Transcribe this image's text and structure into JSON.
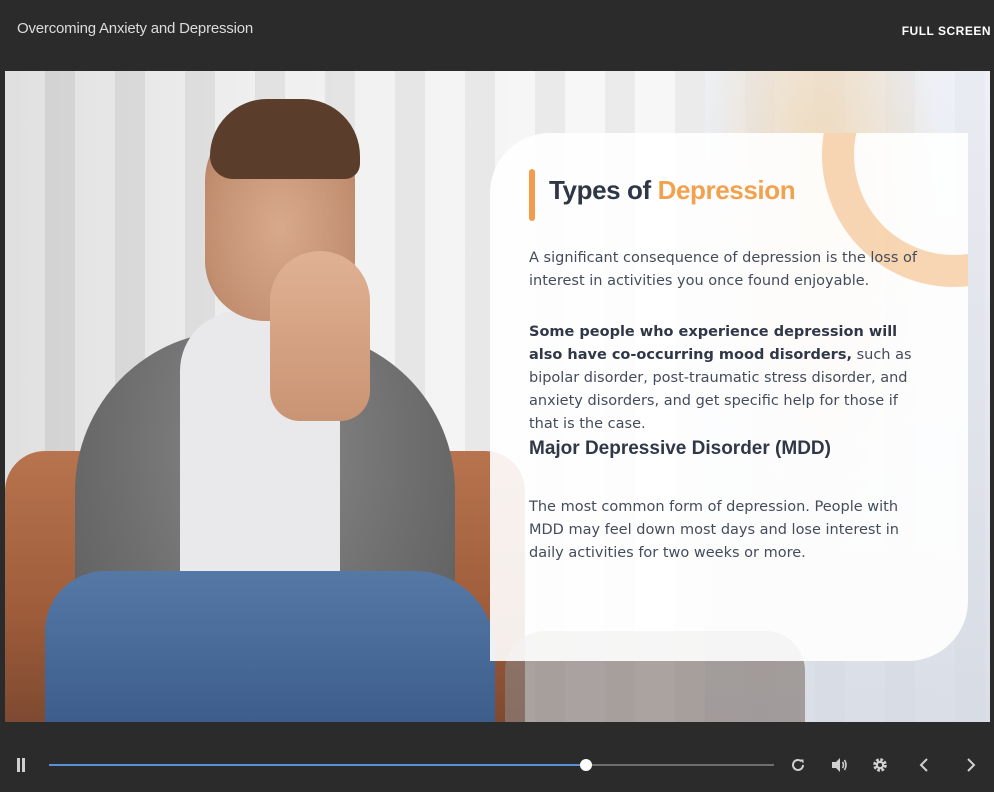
{
  "header": {
    "course_title": "Overcoming Anxiety and Depression",
    "fullscreen_label": "FULL SCREEN"
  },
  "slide": {
    "title_part1": "Types of",
    "title_highlight": "Depression",
    "paragraph1": "A significant consequence of depression is the loss of interest in activities you once found enjoyable.",
    "paragraph2_bold": "Some people who experience depression will also have co-occurring mood disorders,",
    "paragraph2_rest": " such as bipolar disorder, post-traumatic stress disorder, and anxiety disorders, and get specific help for those if that is the case.",
    "subheading": "Major Depressive Disorder (MDD)",
    "paragraph3": "The most common form of depression. People with MDD may feel down most days and lose interest in daily activities for two weeks or more."
  },
  "player": {
    "progress_fraction": 0.74,
    "icons": [
      "pause-icon",
      "replay-icon",
      "volume-icon",
      "settings-icon",
      "previous-icon",
      "next-icon"
    ]
  },
  "colors": {
    "accent_orange": "#f39c4d",
    "progress_blue": "#5b8fd6",
    "background_dark": "#2b2b2b"
  }
}
